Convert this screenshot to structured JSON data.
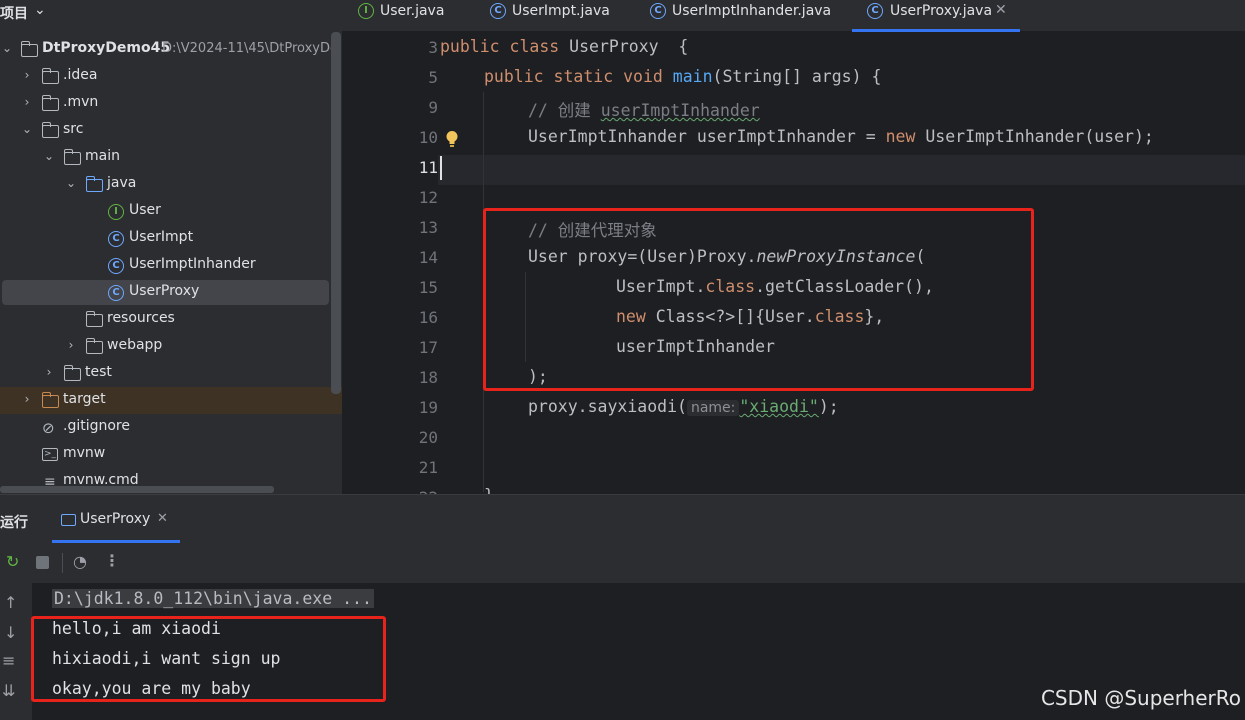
{
  "project": {
    "title": "项目",
    "tree": [
      {
        "label": "DtProxyDemo45",
        "path": "D:\\V2024-11\\45\\DtProxyDe",
        "icon": "folder-icon"
      },
      {
        "label": ".idea",
        "icon": "folder-icon"
      },
      {
        "label": ".mvn",
        "icon": "folder-icon"
      },
      {
        "label": "src",
        "icon": "folder-icon"
      },
      {
        "label": "main",
        "icon": "folder-icon"
      },
      {
        "label": "java",
        "icon": "source-folder-icon"
      },
      {
        "label": "User",
        "icon": "interface-icon",
        "glyph": "I"
      },
      {
        "label": "UserImpt",
        "icon": "class-icon",
        "glyph": "C"
      },
      {
        "label": "UserImptInhander",
        "icon": "class-icon",
        "glyph": "C"
      },
      {
        "label": "UserProxy",
        "icon": "class-icon",
        "glyph": "C"
      },
      {
        "label": "resources",
        "icon": "resources-folder-icon"
      },
      {
        "label": "webapp",
        "icon": "folder-icon"
      },
      {
        "label": "test",
        "icon": "folder-icon"
      },
      {
        "label": "target",
        "icon": "excluded-folder-icon"
      },
      {
        "label": ".gitignore",
        "icon": "ignore-file-icon"
      },
      {
        "label": "mvnw",
        "icon": "terminal-file-icon"
      },
      {
        "label": "mvnw.cmd",
        "icon": "text-file-icon"
      }
    ]
  },
  "tabs": [
    {
      "label": "User.java",
      "glyph": "I"
    },
    {
      "label": "UserImpt.java",
      "glyph": "C"
    },
    {
      "label": "UserImptInhander.java",
      "glyph": "C"
    },
    {
      "label": "UserProxy.java",
      "glyph": "C",
      "close": "✕"
    }
  ],
  "editor": {
    "line_numbers": [
      "3",
      "5",
      "9",
      "10",
      "11",
      "12",
      "13",
      "14",
      "15",
      "16",
      "17",
      "18",
      "19",
      "20",
      "21",
      "22"
    ],
    "current_line": "11",
    "lines": {
      "l3": {
        "kw1": "public",
        "kw2": "class",
        "name": "UserProxy",
        "rest": "  {"
      },
      "l5": {
        "kw1": "public",
        "kw2": "static",
        "kw3": "void",
        "fn": "main",
        "rest": "(String[] args) {"
      },
      "l9": {
        "comment": "// 创建 ",
        "comment_word": "userImptInhander"
      },
      "l10": {
        "a": "UserImptInhander userImptInhander = ",
        "kw": "new",
        "b": " UserImptInhander(user);"
      },
      "l13": {
        "comment": "// 创建代理对象"
      },
      "l14": {
        "a": "User proxy=(User)Proxy.",
        "method": "newProxyInstance",
        "b": "("
      },
      "l15": {
        "a": "UserImpt.",
        "kw": "class",
        "b": ".getClassLoader(),"
      },
      "l16": {
        "kw": "new",
        "a": " Class<?>[]{User.",
        "kw2": "class",
        "b": "},"
      },
      "l17": {
        "a": "userImptInhander"
      },
      "l18": {
        "a": ");"
      },
      "l19": {
        "a": "proxy.sayxiaodi(",
        "hint": "name:",
        "str": "\"xiaodi\"",
        "b": ");"
      },
      "l22": {
        "a": "}"
      }
    }
  },
  "run": {
    "title": "运行",
    "tab_label": "UserProxy",
    "tab_close": "✕",
    "console": {
      "command": "D:\\jdk1.8.0_112\\bin\\java.exe ...",
      "output": [
        "hello,i am xiaodi",
        "hixiaodi,i want sign up",
        "okay,you are my baby"
      ]
    }
  },
  "watermark": "CSDN @SuperherRo",
  "colors": {
    "highlight_box": "#e8231c",
    "accent": "#3574f0"
  }
}
